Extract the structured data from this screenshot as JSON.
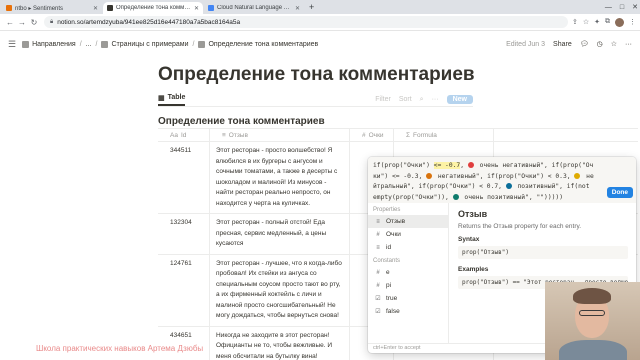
{
  "browser": {
    "tabs": [
      {
        "label": "ntbo ▸ Sentiments",
        "color": "#e8710a",
        "active": false
      },
      {
        "label": "Определение тона комментари…",
        "color": "#37352f",
        "active": true
      },
      {
        "label": "Cloud Natural Language API - …",
        "color": "#4285f4",
        "active": false
      }
    ],
    "new_tab": "+",
    "url": "notion.so/artemdzyuba/941ee825d16e447180a7a5bac8164a5a"
  },
  "topbar": {
    "breadcrumbs": [
      "Направления",
      "...",
      "Страницы с примерами",
      "Определение тона комментариев"
    ],
    "edited": "Edited Jun 3",
    "share": "Share"
  },
  "page": {
    "title": "Определение тона комментариев",
    "view_tab": "Table",
    "filter": "Filter",
    "sort": "Sort",
    "new_button": "New",
    "db_title": "Определение тона комментариев"
  },
  "table": {
    "headers": [
      "Id",
      "Отзыв",
      "Очки",
      "Formula"
    ],
    "rows": [
      {
        "id": "344511",
        "text": "Этот ресторан - просто волшебство! Я влюбился в их бургеры с ангусом и сочными томатами, а также в десерты с шоколадом и малиной! Из минусов - найти ресторан реально непросто, он находится у черта на куличках."
      },
      {
        "id": "132304",
        "text": "Этот ресторан - полный отстой! Еда пресная, сервис медленный, а цены кусаются"
      },
      {
        "id": "124761",
        "text": "Этот ресторан - лучшее, что я когда-либо пробовал! Их стейки из ангуса со специальным соусом просто тают во рту, а их фирменный коктейль с личи и малиной просто сногсшибательный! Не могу дождаться, чтобы вернуться снова!"
      },
      {
        "id": "434651",
        "text": "Никогда не заходите в этот ресторан! Официанты не то, чтобы вежливые. И меня обсчитали на бутылку вина!"
      }
    ]
  },
  "formula": {
    "code_parts": [
      {
        "t": "if(prop(\"Очки\") "
      },
      {
        "t": "<= -0.7",
        "hl": true
      },
      {
        "t": ", "
      },
      {
        "dot": "#e03e3e"
      },
      {
        "t": " очень негативный\", if(prop(\"Очки\") <= -0.3, "
      },
      {
        "dot": "#d9730d"
      },
      {
        "t": " негативный\", if(prop(\"Очки\") < 0.3, "
      },
      {
        "dot": "#dfab01"
      },
      {
        "t": " нейтральный\", if(prop(\"Очки\") < 0.7, "
      },
      {
        "dot": "#0b6e99"
      },
      {
        "t": " позитивный\", if(not empty(prop(\"Очки\")), "
      },
      {
        "dot": "#0f7b6c"
      },
      {
        "t": " очень позитивный\", \"\")))))"
      }
    ],
    "done": "Done",
    "properties_label": "Properties",
    "properties": [
      {
        "icon": "≡",
        "name": "Отзыв",
        "selected": true
      },
      {
        "icon": "#",
        "name": "Очки",
        "selected": false
      },
      {
        "icon": "≡",
        "name": "id",
        "selected": false
      }
    ],
    "constants_label": "Constants",
    "constants": [
      {
        "icon": "#",
        "name": "e"
      },
      {
        "icon": "#",
        "name": "pi"
      },
      {
        "icon": "☑",
        "name": "true"
      },
      {
        "icon": "☑",
        "name": "false"
      }
    ],
    "detail": {
      "title": "Отзыв",
      "desc": "Returns the Отзыв property for each entry.",
      "syntax_label": "Syntax",
      "syntax": "prop(\"Отзыв\")",
      "examples_label": "Examples",
      "example": "prop(\"Отзыв\") == \"Этот ресторан - просто волшебство"
    },
    "footer": "ctrl+Enter to accept"
  },
  "watermark": "Школа практических навыков Артема Дзюбы"
}
